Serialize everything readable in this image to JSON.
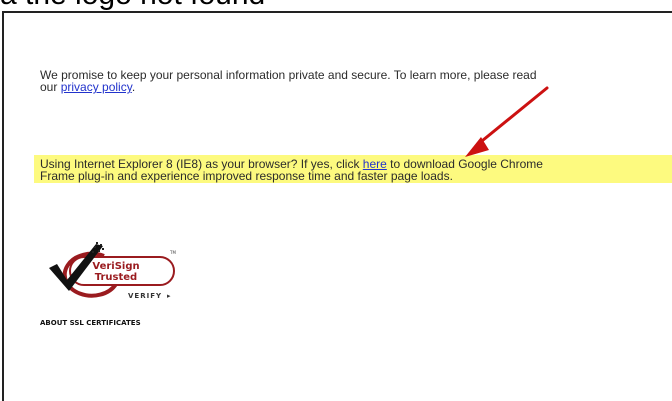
{
  "caption": "a the logo not found",
  "privacy": {
    "line1": "We promise to keep your personal information private and secure. To learn more, please read",
    "line2_prefix": "our ",
    "link_text": "privacy policy",
    "line2_suffix": "."
  },
  "ie8": {
    "line1_prefix": "Using Internet Explorer 8 (IE8) as your browser? If yes, click ",
    "link_text": "here",
    "line1_suffix": " to download Google Chrome",
    "line2": "Frame plug-in and experience improved response time and faster page loads.",
    "highlight_color": "#fdfa7f"
  },
  "seal": {
    "line1": "VeriSign",
    "line2": "Trusted",
    "tm": "TM",
    "verify_label": "VERIFY",
    "verify_arrow": "▸"
  },
  "ssl_link": "ABOUT SSL CERTIFICATES",
  "colors": {
    "link": "#2233cc",
    "arrow": "#cc1111",
    "seal_red": "#9a1b1f"
  }
}
